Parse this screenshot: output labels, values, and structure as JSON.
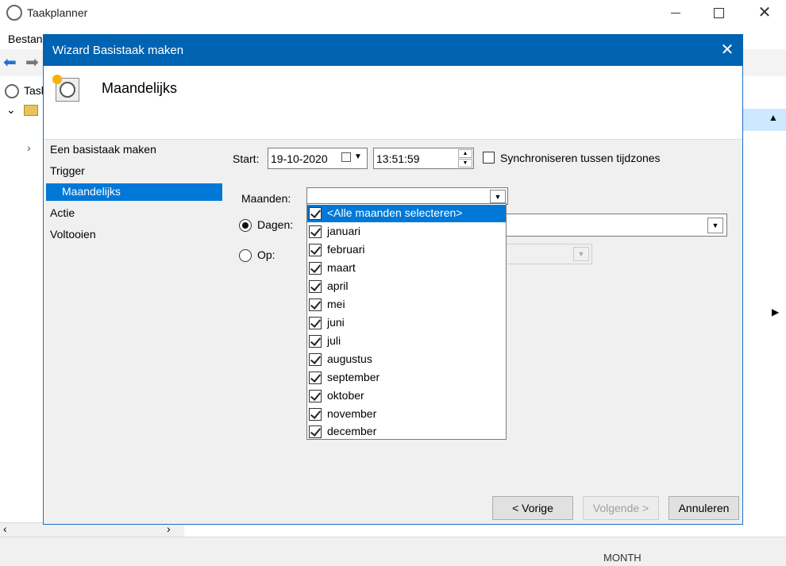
{
  "app": {
    "title": "Taakplanner",
    "menu_first": "Bestan",
    "tree_root": "Tasl",
    "status_partial": "MONTH"
  },
  "dialog": {
    "title": "Wizard Basistaak maken",
    "heading": "Maandelijks",
    "steps": [
      "Een basistaak maken",
      "Trigger",
      "Maandelijks",
      "Actie",
      "Voltooien"
    ],
    "start_label": "Start:",
    "start_date": "19-10-2020",
    "start_time": "13:51:59",
    "sync_label": "Synchroniseren tussen tijdzones",
    "months_label": "Maanden:",
    "days_label": "Dagen:",
    "on_label": "Op:",
    "months": [
      "<Alle maanden selecteren>",
      "januari",
      "februari",
      "maart",
      "april",
      "mei",
      "juni",
      "juli",
      "augustus",
      "september",
      "oktober",
      "november",
      "december"
    ],
    "buttons": {
      "back": "< Vorige",
      "next": "Volgende >",
      "cancel": "Annuleren"
    }
  }
}
